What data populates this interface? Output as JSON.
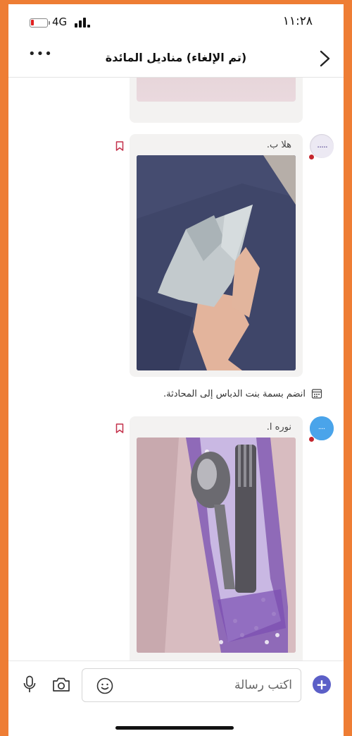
{
  "status_bar": {
    "network": "4G",
    "time": "١١:٢٨",
    "battery_level": 0.12
  },
  "header": {
    "title": "(تم الإلغاء) مناديل المائدة",
    "more_icon": "more-icon",
    "back_icon": "chevron-right-icon"
  },
  "messages": [
    {
      "sender": "هلا ب.",
      "type": "image",
      "image_desc": "folded-napkin-photo"
    },
    {
      "sender": "نوره ا.",
      "type": "image",
      "image_desc": "cutlery-pouch-photo"
    }
  ],
  "system_message": {
    "text": "انضم بسمة بنت الدباس إلى المحادثة."
  },
  "composer": {
    "placeholder": "اكتب رسالة"
  },
  "colors": {
    "accent": "#5b5fc7",
    "presence_busy": "#c4262e",
    "bookmark": "#c4314b",
    "frame": "#ee7d34"
  }
}
